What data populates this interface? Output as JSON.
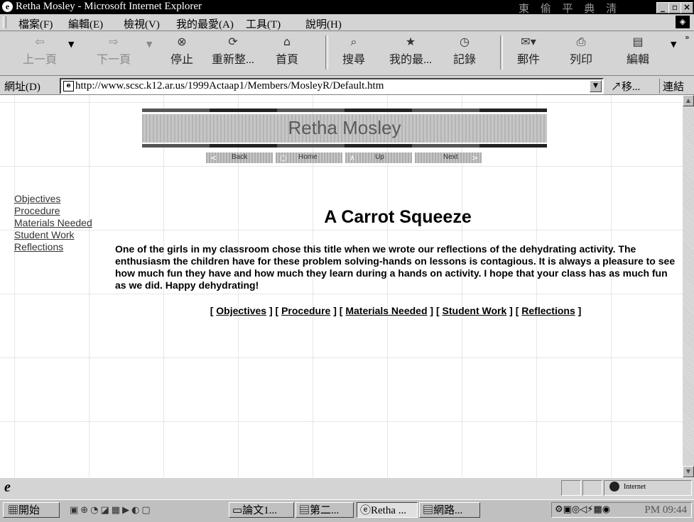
{
  "window": {
    "title": "Retha Mosley - Microsoft Internet Explorer",
    "faded_text": "東 偷 平 典 淸"
  },
  "menu": [
    "檔案(F)",
    "編輯(E)",
    "檢視(V)",
    "我的最愛(A)",
    "工具(T)",
    "說明(H)"
  ],
  "toolbar": {
    "back": "上一頁",
    "forward": "下一頁",
    "stop": "停止",
    "refresh": "重新整...",
    "home": "首頁",
    "search": "搜尋",
    "favorites": "我的最...",
    "history": "記錄",
    "mail": "郵件",
    "print": "列印",
    "edit": "編輯"
  },
  "address": {
    "label": "網址(D)",
    "url": "http://www.scsc.k12.ar.us/1999Actaap1/Members/MosleyR/Default.htm",
    "go": "移...",
    "links": "連結"
  },
  "page": {
    "banner_title": "Retha Mosley",
    "nav": [
      "Back",
      "Home",
      "Up",
      "Next"
    ],
    "side_links": [
      "Objectives",
      "Procedure",
      "Materials Needed",
      "Student Work",
      "Reflections"
    ],
    "heading": "A Carrot Squeeze",
    "paragraph": "One of the girls in my classroom chose this title when we wrote  our reflections of the dehydrating activity.  The enthusiasm the children have for these problem solving-hands on lessons is contagious.  It is always a pleasure to see how much fun they have and how much they learn during a hands on activity.  I hope that your class has as much fun as we did.  Happy dehydrating!",
    "bottom_links": [
      "Objectives",
      "Procedure",
      "Materials Needed",
      "Student Work",
      "Reflections"
    ]
  },
  "status": {
    "zone": "Internet"
  },
  "taskbar": {
    "start": "開始",
    "tasks": [
      "論文1...",
      "第二...",
      "Retha ...",
      "網路..."
    ],
    "clock": "PM 09:44"
  }
}
